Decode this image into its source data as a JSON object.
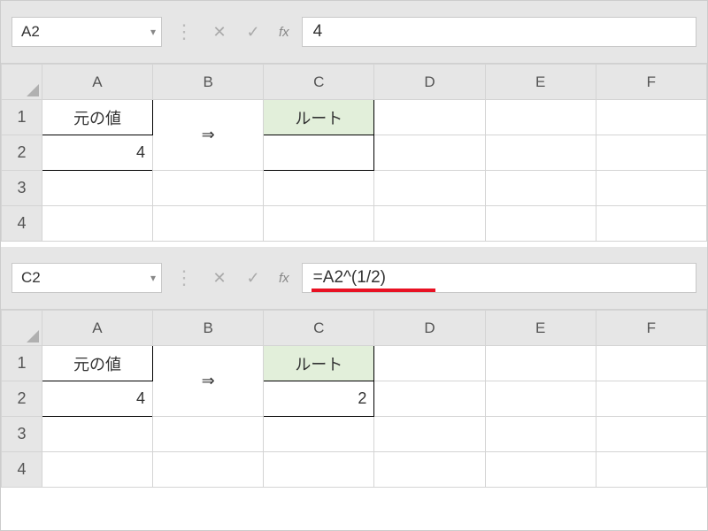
{
  "panel1": {
    "nameBox": "A2",
    "formulaValue": "4",
    "fxLabel": "fx",
    "columns": [
      "A",
      "B",
      "C",
      "D",
      "E",
      "F"
    ],
    "rows": [
      "1",
      "2",
      "3",
      "4"
    ],
    "cells": {
      "A1": "元の値",
      "A2": "4",
      "B_arrow": "⇒",
      "C1": "ルート",
      "C2": ""
    }
  },
  "panel2": {
    "nameBox": "C2",
    "formulaValue": "=A2^(1/2)",
    "fxLabel": "fx",
    "columns": [
      "A",
      "B",
      "C",
      "D",
      "E",
      "F"
    ],
    "rows": [
      "1",
      "2",
      "3",
      "4"
    ],
    "cells": {
      "A1": "元の値",
      "A2": "4",
      "B_arrow": "⇒",
      "C1": "ルート",
      "C2": "2"
    }
  }
}
